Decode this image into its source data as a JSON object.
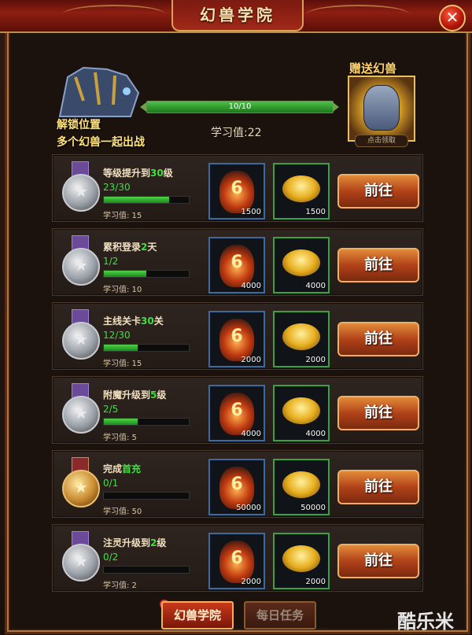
{
  "window": {
    "title": "幻兽学院",
    "close_icon": "close-icon"
  },
  "header": {
    "unlock_line1": "解锁位置",
    "unlock_line2": "多个幻兽一起出战",
    "progress_text": "10/10",
    "progress_fraction": 1.0,
    "study_value": "学习值:22",
    "gift_title": "赠送幻兽",
    "gift_claim": "点击领取"
  },
  "tasks": [
    {
      "title_pre": "等级提升到",
      "title_hl": "30",
      "title_post": "级",
      "progress": "23/30",
      "fraction": 0.767,
      "xp": "学习值: 15",
      "stone": "1500",
      "gold": "1500",
      "button": "前往",
      "medal": "silver"
    },
    {
      "title_pre": "累积登录",
      "title_hl": "2",
      "title_post": "天",
      "progress": "1/2",
      "fraction": 0.5,
      "xp": "学习值: 10",
      "stone": "4000",
      "gold": "4000",
      "button": "前往",
      "medal": "silver"
    },
    {
      "title_pre": "主线关卡",
      "title_hl": "30",
      "title_post": "关",
      "progress": "12/30",
      "fraction": 0.4,
      "xp": "学习值: 15",
      "stone": "2000",
      "gold": "2000",
      "button": "前往",
      "medal": "silver"
    },
    {
      "title_pre": "附魔升级到",
      "title_hl": "5",
      "title_post": "级",
      "progress": "2/5",
      "fraction": 0.4,
      "xp": "学习值: 5",
      "stone": "4000",
      "gold": "4000",
      "button": "前往",
      "medal": "silver"
    },
    {
      "title_pre": "完成",
      "title_hl": "首充",
      "title_post": "",
      "progress": "0/1",
      "fraction": 0.0,
      "xp": "学习值: 50",
      "stone": "50000",
      "gold": "50000",
      "button": "前往",
      "medal": "gold"
    },
    {
      "title_pre": "注灵升级到",
      "title_hl": "2",
      "title_post": "级",
      "progress": "0/2",
      "fraction": 0.0,
      "xp": "学习值: 2",
      "stone": "2000",
      "gold": "2000",
      "button": "前往",
      "medal": "silver"
    }
  ],
  "tabs": {
    "academy": "幻兽学院",
    "daily": "每日任务"
  },
  "watermark": "酷乐米",
  "colors": {
    "highlight": "#3fe040",
    "button": "#b2421a"
  }
}
